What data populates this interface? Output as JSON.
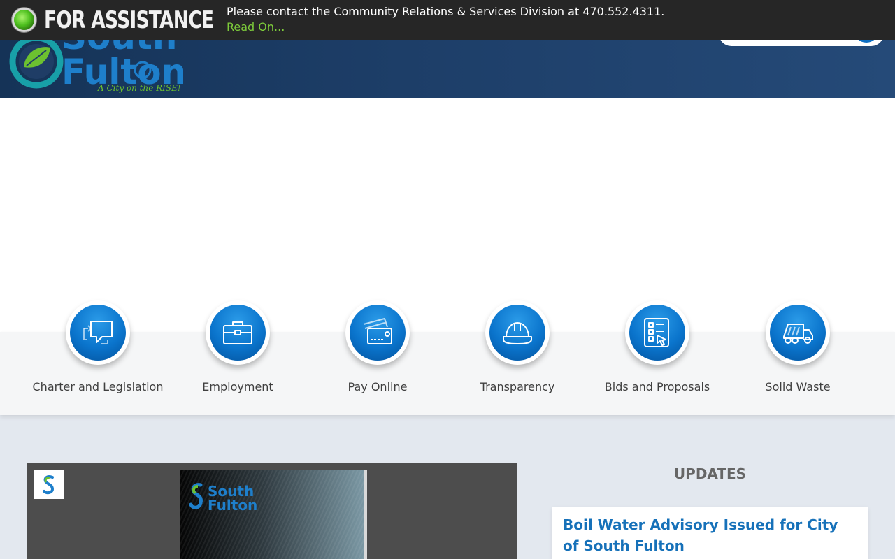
{
  "alert": {
    "title": "FOR ASSISTANCE",
    "message": "Please contact the Community Relations & Services Division at 470.552.4311.",
    "link": "Read On..."
  },
  "header": {
    "logo_text_top": "South",
    "logo_text_bottom": "Fulton",
    "logo_tagline": "A City on the RISE!"
  },
  "quick_links": [
    {
      "label": "Charter and Legislation",
      "icon": "chat-bubbles-icon"
    },
    {
      "label": "Employment",
      "icon": "briefcase-icon"
    },
    {
      "label": "Pay Online",
      "icon": "credit-card-icon"
    },
    {
      "label": "Transparency",
      "icon": "hard-hat-icon"
    },
    {
      "label": "Bids and Proposals",
      "icon": "checklist-icon"
    },
    {
      "label": "Solid Waste",
      "icon": "garbage-truck-icon"
    }
  ],
  "media": {
    "thumb_text_top": "South",
    "thumb_text_bottom": "Fulton"
  },
  "updates": {
    "title": "UPDATES",
    "items": [
      {
        "headline": "Boil Water Advisory Issued for City of South Fulton"
      }
    ]
  },
  "colors": {
    "header_bg": "#1d3e68",
    "brand_blue": "#0d6ec2",
    "brand_green": "#4ec01f",
    "alert_bg": "#262626",
    "link_green": "#7ecc3b",
    "headline_blue": "#1671b9"
  }
}
